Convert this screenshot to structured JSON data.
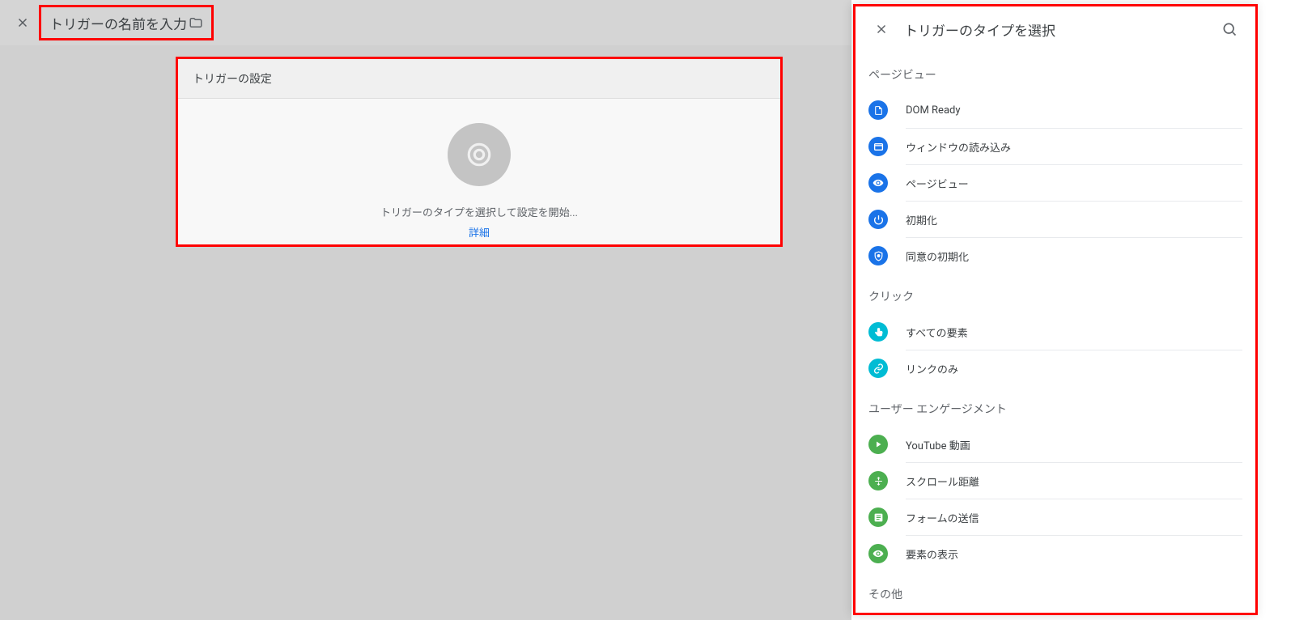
{
  "header": {
    "title": "トリガーの名前を入力"
  },
  "settings": {
    "heading": "トリガーの設定",
    "prompt": "トリガーのタイプを選択して設定を開始...",
    "detail_link": "詳細"
  },
  "panel": {
    "title": "トリガーのタイプを選択",
    "categories": [
      {
        "label": "ページビュー",
        "items": [
          {
            "label": "DOM Ready",
            "icon": "page-blue",
            "color": "blue"
          },
          {
            "label": "ウィンドウの読み込み",
            "icon": "window-blue",
            "color": "blue"
          },
          {
            "label": "ページビュー",
            "icon": "eye-blue",
            "color": "blue"
          },
          {
            "label": "初期化",
            "icon": "power-blue",
            "color": "blue"
          },
          {
            "label": "同意の初期化",
            "icon": "shield-blue",
            "color": "blue"
          }
        ]
      },
      {
        "label": "クリック",
        "items": [
          {
            "label": "すべての要素",
            "icon": "click-cyan",
            "color": "cyan"
          },
          {
            "label": "リンクのみ",
            "icon": "link-cyan",
            "color": "cyan"
          }
        ]
      },
      {
        "label": "ユーザー エンゲージメント",
        "items": [
          {
            "label": "YouTube 動画",
            "icon": "play-green",
            "color": "green"
          },
          {
            "label": "スクロール距離",
            "icon": "scroll-green",
            "color": "green"
          },
          {
            "label": "フォームの送信",
            "icon": "form-green",
            "color": "green"
          },
          {
            "label": "要素の表示",
            "icon": "eye-green",
            "color": "green"
          }
        ]
      },
      {
        "label": "その他",
        "items": []
      }
    ]
  }
}
